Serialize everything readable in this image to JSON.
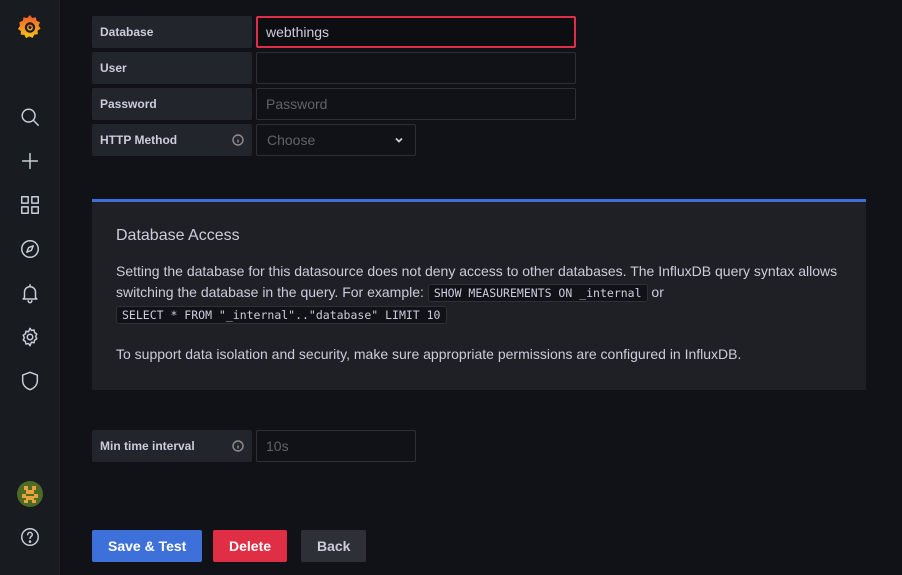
{
  "fields": {
    "database": {
      "label": "Database",
      "value": "webthings"
    },
    "user": {
      "label": "User",
      "value": ""
    },
    "password": {
      "label": "Password",
      "placeholder": "Password"
    },
    "http_method": {
      "label": "HTTP Method",
      "placeholder": "Choose"
    },
    "min_time_interval": {
      "label": "Min time interval",
      "placeholder": "10s"
    }
  },
  "access": {
    "title": "Database Access",
    "text_part1": "Setting the database for this datasource does not deny access to other databases. The InfluxDB query syntax allows switching the database in the query. For example:",
    "code1": "SHOW MEASUREMENTS ON _internal",
    "or": "or",
    "code2": "SELECT * FROM \"_internal\"..\"database\" LIMIT 10",
    "text2": "To support data isolation and security, make sure appropriate permissions are configured in InfluxDB."
  },
  "buttons": {
    "save": "Save & Test",
    "delete": "Delete",
    "back": "Back"
  },
  "colors": {
    "accent": "#3d71d9",
    "danger": "#e02f44",
    "highlight_border": "#e02f44"
  }
}
